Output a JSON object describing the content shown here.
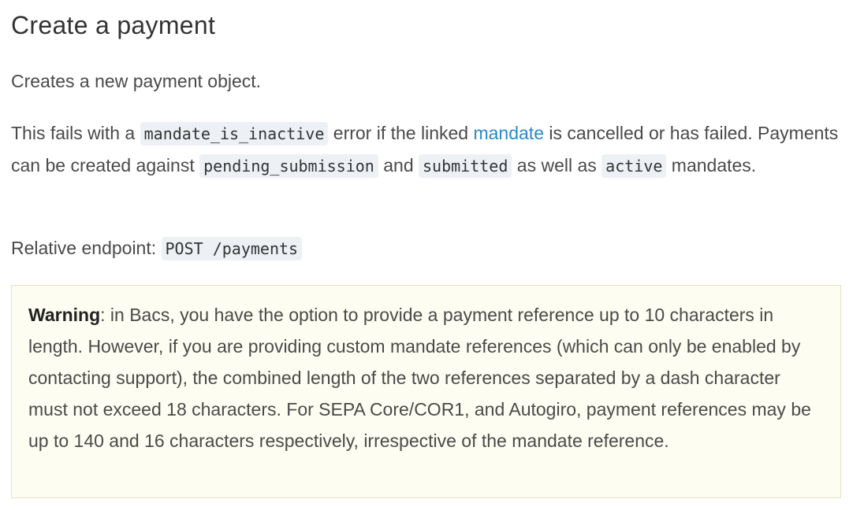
{
  "heading": "Create a payment",
  "intro": "Creates a new payment object.",
  "paragraph2": {
    "text_1": "This fails with a ",
    "code_1": "mandate_is_inactive",
    "text_2": " error if the linked ",
    "link": "mandate",
    "text_3": " is cancelled or has failed. Payments can be created against ",
    "code_2": "pending_submission",
    "text_4": " and ",
    "code_3": "submitted",
    "text_5": " as well as ",
    "code_4": "active",
    "text_6": " mandates."
  },
  "endpoint": {
    "label": "Relative endpoint: ",
    "code": "POST /payments"
  },
  "warning": {
    "label": "Warning",
    "text": ": in Bacs, you have the option to provide a payment reference up to 10 characters in length. However, if you are providing custom mandate references (which can only be enabled by contacting support), the combined length of the two references separated by a dash character must not exceed 18 characters. For SEPA Core/COR1, and Autogiro, payment references may be up to 140 and 16 characters respectively, irrespective of the mandate reference."
  },
  "colors": {
    "link": "#2a8ac8",
    "code_background": "#edf1f5",
    "warning_background": "#fdfdf1",
    "warning_border": "#e4e2c4"
  }
}
